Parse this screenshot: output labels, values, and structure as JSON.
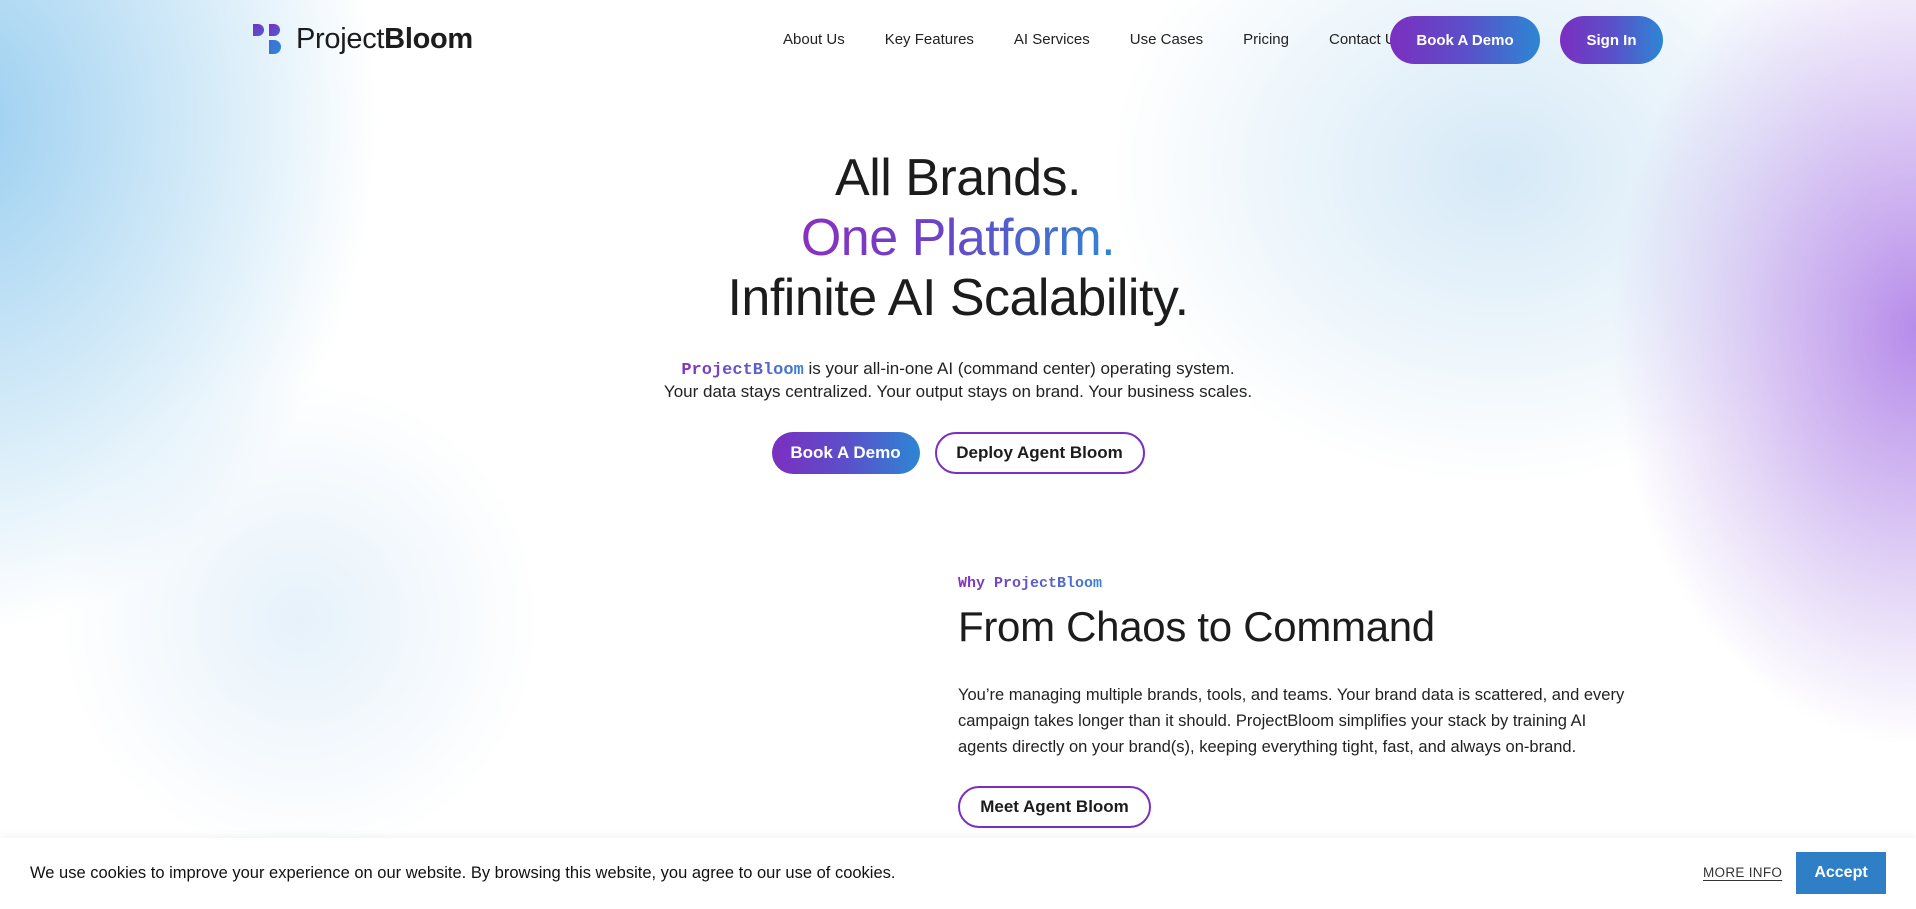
{
  "brand": {
    "name_light": "Project",
    "name_bold": "Bloom",
    "logo_icon": "projectbloom-logo-icon"
  },
  "nav": {
    "links": [
      "About Us",
      "Key Features",
      "AI Services",
      "Use Cases",
      "Pricing",
      "Contact Us"
    ],
    "book_demo": "Book A Demo",
    "sign_in": "Sign In"
  },
  "hero": {
    "line1": "All Brands.",
    "line2": "One Platform.",
    "line3": "Infinite AI Scalability.",
    "sub_brand": "ProjectBloom",
    "sub_line1_rest": "is your all-in-one AI (command center) operating system.",
    "sub_line2": "Your data stays centralized. Your output stays on brand. Your business scales.",
    "cta_primary": "Book A Demo",
    "cta_secondary": "Deploy Agent Bloom"
  },
  "why": {
    "eyebrow": "Why ProjectBloom",
    "title": "From Chaos to Command",
    "body": "You’re managing multiple brands, tools, and teams. Your brand data is scattered, and every campaign takes longer than it should. ProjectBloom simplifies your stack by training AI agents directly on your brand(s), keeping everything tight, fast, and always on-brand.",
    "cta": "Meet Agent Bloom"
  },
  "cookie": {
    "text": "We use cookies to improve your experience on our website. By browsing this website, you agree to our use of cookies.",
    "more_info": "MORE INFO",
    "accept": "Accept"
  },
  "colors": {
    "gradient_start": "#7b2fc0",
    "gradient_end": "#2d86d4",
    "accept_button": "#2f7fc7"
  }
}
